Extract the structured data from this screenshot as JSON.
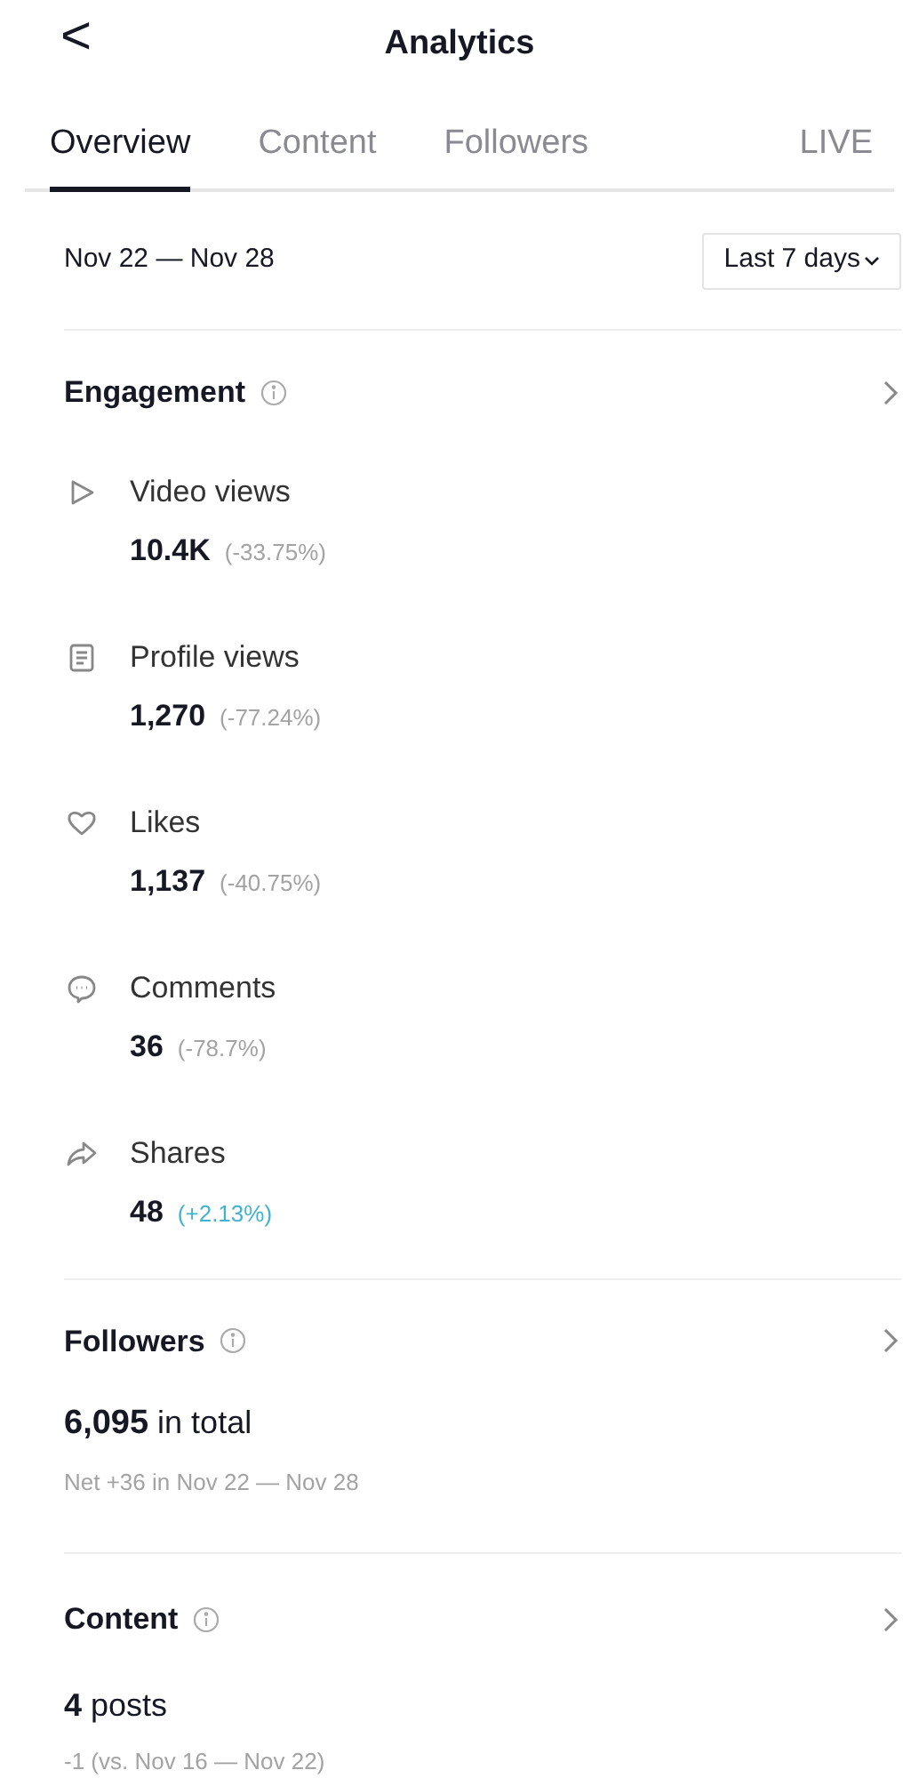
{
  "header": {
    "back": "<",
    "title": "Analytics"
  },
  "tabs": [
    {
      "label": "Overview",
      "selected": true
    },
    {
      "label": "Content",
      "selected": false
    },
    {
      "label": "Followers",
      "selected": false
    },
    {
      "label": "LIVE",
      "selected": false
    }
  ],
  "date_range": {
    "label": "Nov 22 — Nov 28",
    "dropdown": "Last 7 days"
  },
  "engagement": {
    "title": "Engagement",
    "metrics": [
      {
        "kind": "play",
        "label": "Video views",
        "value": "10.4K",
        "change": "(-33.75%)",
        "color": "#a3a3a3"
      },
      {
        "kind": "profile",
        "label": "Profile views",
        "value": "1,270",
        "change": "(-77.24%)",
        "color": "#a3a3a3"
      },
      {
        "kind": "like",
        "label": "Likes",
        "value": "1,137",
        "change": "(-40.75%)",
        "color": "#a3a3a3"
      },
      {
        "kind": "comment",
        "label": "Comments",
        "value": "36",
        "change": "(-78.7%)",
        "color": "#a3a3a3"
      },
      {
        "kind": "share",
        "label": "Shares",
        "value": "48",
        "change": "(+2.13%)",
        "color": "#3fb3d1"
      }
    ]
  },
  "followers": {
    "title": "Followers",
    "total": "**6,095** in total",
    "net": "Net +36 in Nov 22 — Nov 28"
  },
  "content": {
    "title": "Content",
    "total": "**4** posts",
    "compare": "-1 (vs. Nov 16 — Nov 22)"
  }
}
